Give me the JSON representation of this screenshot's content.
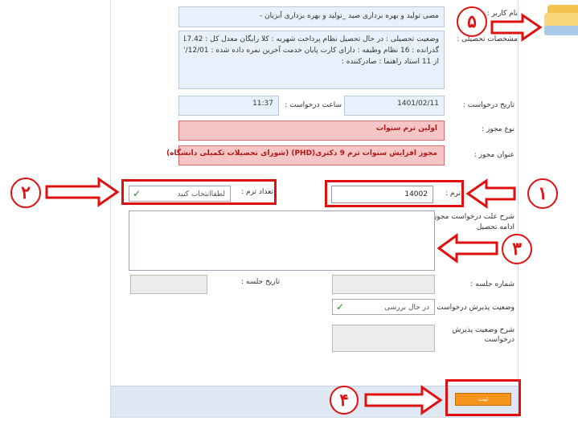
{
  "form": {
    "name_label": "نام کاربر :",
    "name_value": "مصی تولید و بهره برداری صید _تولید و بهره برداری آبزیان -",
    "specs_label": "مشخصات تحصیلی :",
    "specs_line1": "وضعیت تحصیلی : در حال تحصیل   نظام پرداخت شهریه : کلا رایگان   معدل کل : 17.42   تعداد واحد",
    "specs_line2": "گذرانده : 16   نظام وظیفه : دارای کارت پایان خدمت   آخرین نمره داده شده : 1397/12/01   رتبه : 8",
    "specs_line3": "از 11   استاد راهنما :   صادرکننده :",
    "request_date_label": "تاریخ درخواست :",
    "request_date_value": "1401/02/11",
    "request_time_label": "ساعت درخواست :",
    "request_time_value": "11:37",
    "permit_type_label": "نوع مجوز :",
    "permit_type_value": "اولین ترم سنوات",
    "permit_title_label": "عنوان مجوز :",
    "permit_title_value": "مجوز افزایش سنوات ترم 9 دکتری(PHD) (شورای تحصیلات تکمیلی دانشگاه)",
    "term_label": "ترم :",
    "term_value": "14002",
    "term_count_label": "تعداد ترم :",
    "term_count_value": "لطفاانتخاب کنید",
    "reason_label": "شرح علت درخواست مجوز :",
    "reason_label2": "ادامه تحصیل",
    "session_number_label": "شماره جلسه :",
    "session_date_label": "تاریخ جلسه :",
    "acceptance_status_label": "وضعیت پذیرش درخواست :",
    "acceptance_status_value": "در حال بررسی",
    "acceptance_desc_label": "شرح وضعیت پذیرش",
    "acceptance_desc_label2": "درخواست",
    "save_label": "ثبت"
  },
  "callouts": [
    "۱",
    "۲",
    "۳",
    "۴",
    "۵"
  ],
  "colors": {
    "highlight": "#e01010",
    "field_bg": "#e8f1fb",
    "save": "#f7941d",
    "chevron": "#1f8a1f"
  }
}
